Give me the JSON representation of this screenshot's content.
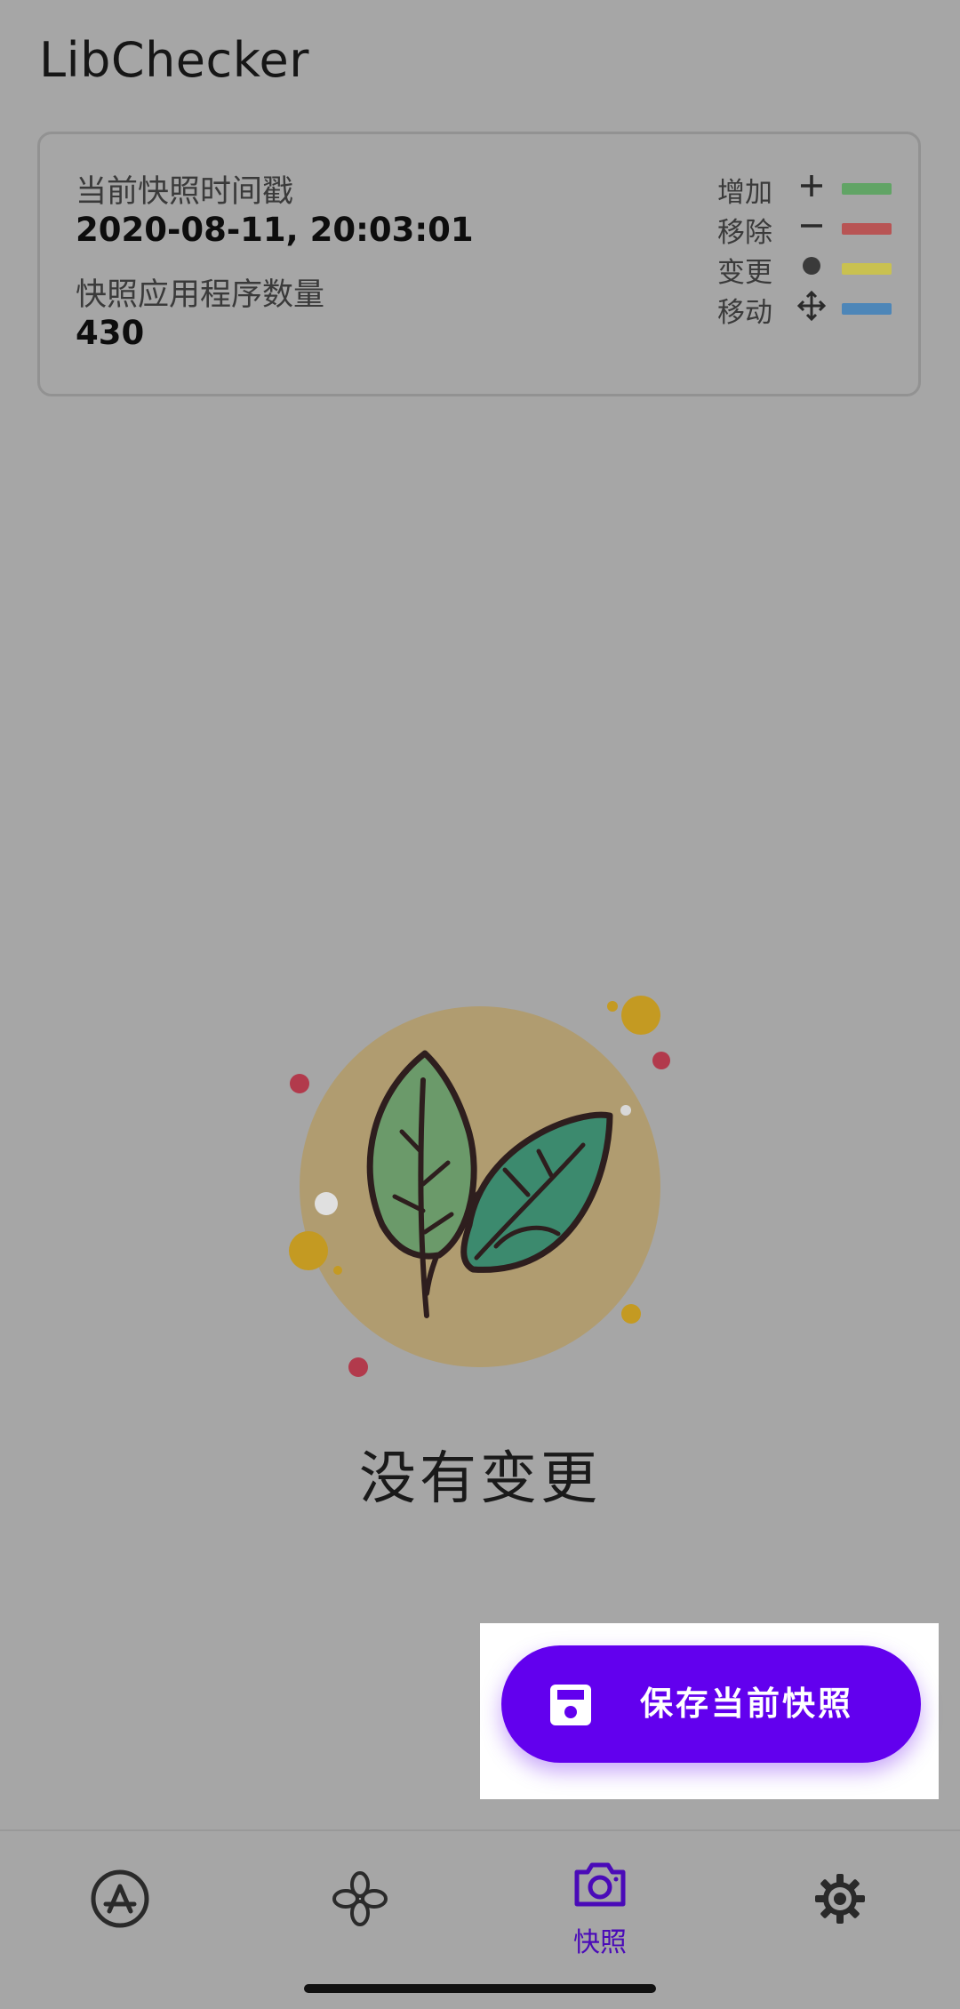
{
  "app": {
    "title": "LibChecker"
  },
  "snapshot_card": {
    "timestamp_label": "当前快照时间戳",
    "timestamp_value": "2020-08-11, 20:03:01",
    "count_label": "快照应用程序数量",
    "count_value": "430"
  },
  "legend": [
    {
      "label": "增加",
      "symbol": "plus-icon",
      "color": "#4caf50"
    },
    {
      "label": "移除",
      "symbol": "minus-icon",
      "color": "#e53935"
    },
    {
      "label": "变更",
      "symbol": "dot-icon",
      "color": "#fdd835"
    },
    {
      "label": "移动",
      "symbol": "move-arrows-icon",
      "color": "#1e88e5"
    }
  ],
  "empty_state": {
    "message": "没有变更",
    "illustration": "leaves-illustration"
  },
  "fab": {
    "label": "保存当前快照",
    "icon": "save-icon",
    "color": "#6200ee"
  },
  "bottom_nav": {
    "items": [
      {
        "icon": "app-store-icon",
        "label": ""
      },
      {
        "icon": "library-icon",
        "label": ""
      },
      {
        "icon": "camera-icon",
        "label": "快照",
        "selected": true
      },
      {
        "icon": "settings-gear-icon",
        "label": ""
      }
    ],
    "accent": "#4a0ab8"
  }
}
